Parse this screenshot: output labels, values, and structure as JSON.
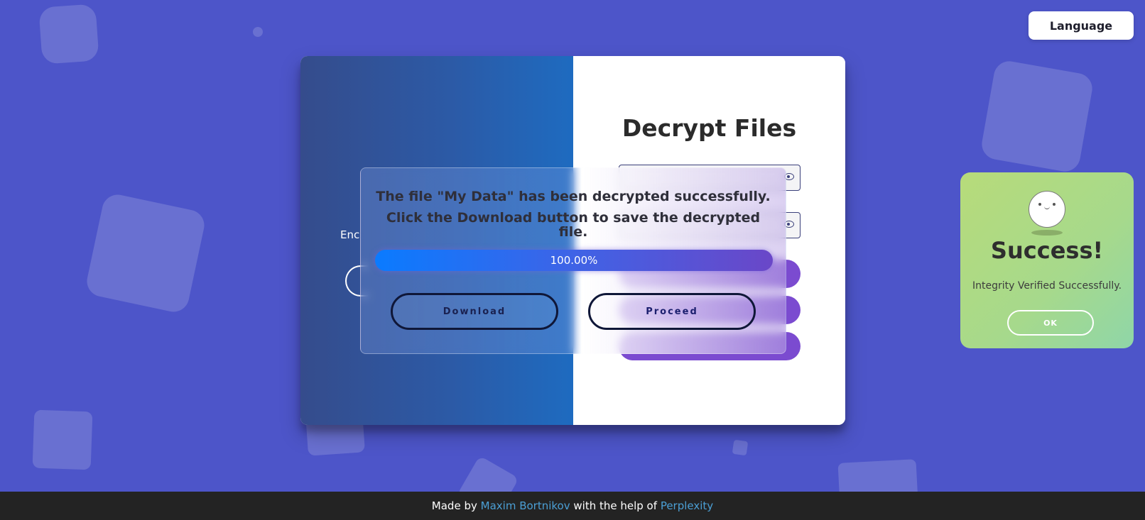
{
  "header": {
    "language_label": "Language"
  },
  "left_panel": {
    "label_fragment": "Enc"
  },
  "right_panel": {
    "title": "Decrypt Files"
  },
  "modal": {
    "message_line1": "The file \"My Data\" has been decrypted successfully.",
    "message_line2": "Click the Download button to save the decrypted file.",
    "progress_text": "100.00%",
    "progress_value": 100,
    "download_label": "Download",
    "proceed_label": "Proceed"
  },
  "toast": {
    "title": "Success!",
    "message": "Integrity Verified Successfully.",
    "ok_label": "OK"
  },
  "footer": {
    "made_by": "Made by",
    "author": "Maxim Bortnikov",
    "with_help": "with the help of",
    "helper": "Perplexity"
  },
  "colors": {
    "background": "#4d55c9",
    "accent_purple": "#7b4bd0",
    "link": "#4b9fd5",
    "toast_green": "#b7db7a"
  }
}
